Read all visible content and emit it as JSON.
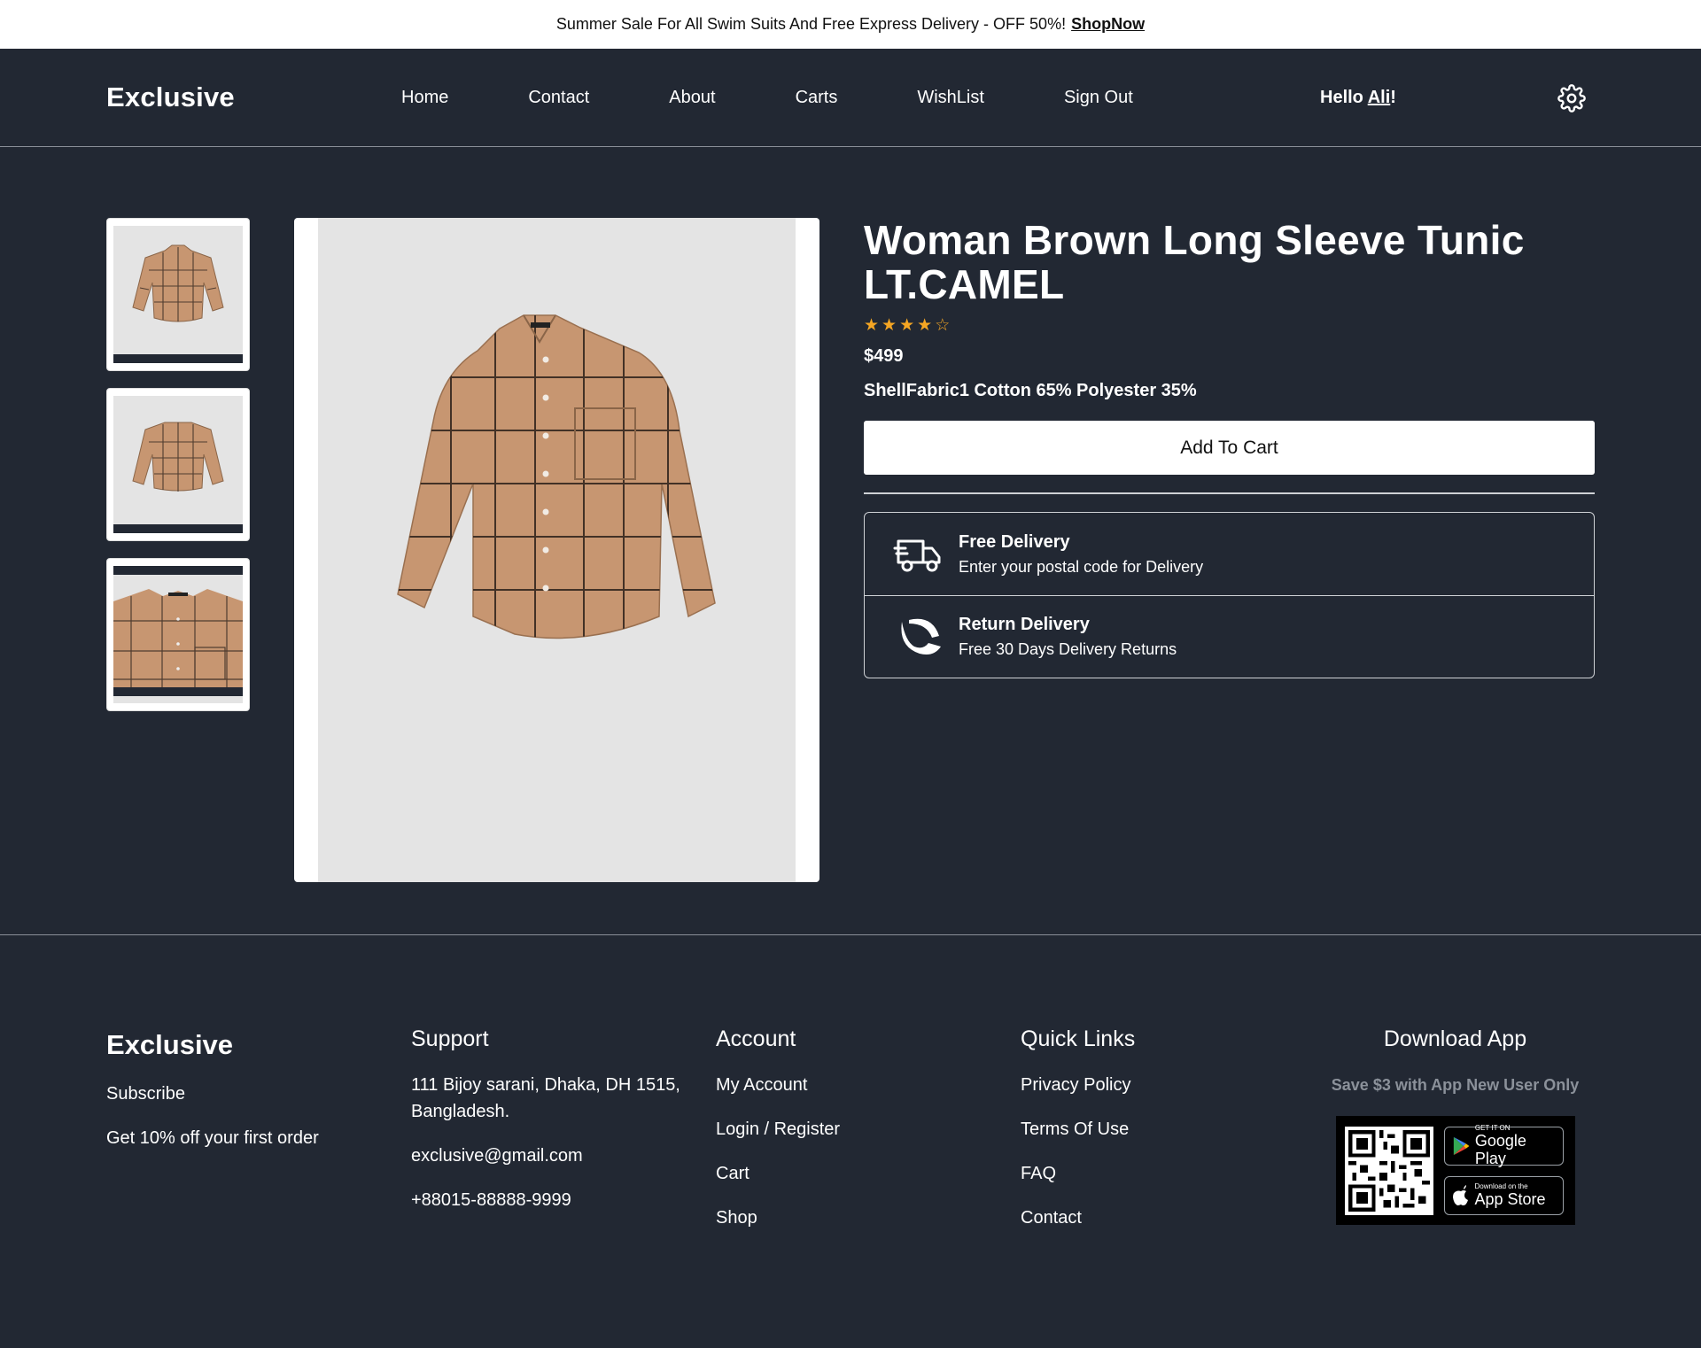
{
  "banner": {
    "text": "Summer Sale For All Swim Suits And Free Express Delivery - OFF 50%!",
    "link": "ShopNow"
  },
  "header": {
    "logo": "Exclusive",
    "nav": [
      "Home",
      "Contact",
      "About",
      "Carts",
      "WishList",
      "Sign Out"
    ],
    "greeting_prefix": "Hello ",
    "greeting_user": "Ali",
    "greeting_suffix": "!",
    "settings_icon": "gear-icon"
  },
  "product": {
    "title": "Woman Brown Long Sleeve Tunic LT.CAMEL",
    "rating": 4.5,
    "price": "$499",
    "fabric": "ShellFabric1 Cotton 65% Polyester 35%",
    "add_to_cart": "Add To Cart",
    "colors": {
      "shirt": "#c79671",
      "check": "#3b2d24"
    },
    "delivery": [
      {
        "title": "Free Delivery",
        "subtitle": "Enter your postal code for Delivery",
        "icon": "truck-icon"
      },
      {
        "title": "Return Delivery",
        "subtitle": "Free 30 Days Delivery Returns",
        "icon": "return-icon"
      }
    ]
  },
  "footer": {
    "brand": "Exclusive",
    "brand_items": [
      "Subscribe",
      "Get 10% off your first order"
    ],
    "support": {
      "title": "Support",
      "items": [
        "111 Bijoy sarani, Dhaka, DH 1515, Bangladesh.",
        "exclusive@gmail.com",
        "+88015-88888-9999"
      ]
    },
    "account": {
      "title": "Account",
      "items": [
        "My Account",
        "Login / Register",
        "Cart",
        "Shop"
      ]
    },
    "quick_links": {
      "title": "Quick Links",
      "items": [
        "Privacy Policy",
        "Terms Of Use",
        "FAQ",
        "Contact"
      ]
    },
    "download": {
      "title": "Download App",
      "subtitle": "Save $3 with App New User Only",
      "google_small": "GET IT ON",
      "google_big": "Google Play",
      "apple_small": "Download on the",
      "apple_big": "App Store"
    }
  }
}
